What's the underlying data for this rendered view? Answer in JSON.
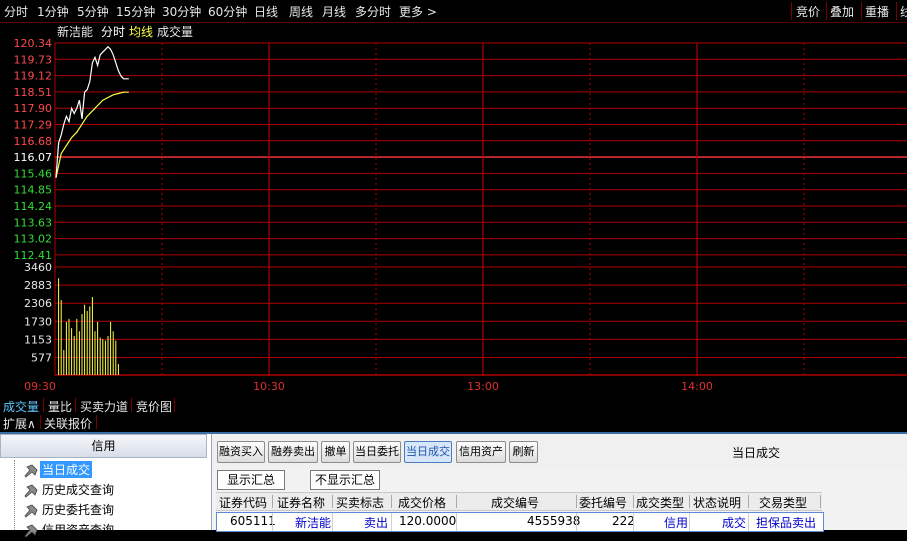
{
  "topbar": {
    "tabs": [
      "分时",
      "1分钟",
      "5分钟",
      "15分钟",
      "30分钟",
      "60分钟",
      "日线",
      "周线",
      "月线",
      "多分时",
      "更多 >"
    ],
    "active_tab": "分时",
    "right_items": [
      "竞价",
      "叠加",
      "重播",
      "线"
    ]
  },
  "chart_header": {
    "stock_name": "新洁能",
    "label_fenshi": "分时",
    "label_junxian": "均线",
    "label_volume": "成交量"
  },
  "colors": {
    "up": "#ff4a4a",
    "down": "#33dd33",
    "base": "#ffffff",
    "grid": "#b00000",
    "price_line": "#ffffff",
    "avg_line": "#ffff44",
    "volume_bar": "#ffff44"
  },
  "chart_data": {
    "type": "line",
    "price_axis": {
      "ticks": [
        "120.34",
        "119.73",
        "119.12",
        "118.51",
        "117.90",
        "117.29",
        "116.68",
        "116.07",
        "115.46",
        "114.85",
        "114.24",
        "113.63",
        "113.02",
        "112.41"
      ],
      "base": "116.07",
      "ylim": [
        112.41,
        120.34
      ]
    },
    "volume_axis": {
      "ticks": [
        "3460",
        "2883",
        "2306",
        "1730",
        "1153",
        "577"
      ],
      "ylim": [
        0,
        3460
      ]
    },
    "time_axis": [
      "09:30",
      "10:30",
      "13:00",
      "14:00"
    ],
    "total_minutes": 240,
    "series": [
      {
        "name": "分时",
        "x": [
          0,
          1,
          2,
          3,
          4,
          5,
          6,
          7,
          8,
          9,
          10,
          11,
          12,
          13,
          14,
          15,
          16,
          17,
          18,
          19,
          20,
          21,
          22,
          23,
          24,
          25,
          26,
          27,
          28
        ],
        "values": [
          115.3,
          116.6,
          116.9,
          117.3,
          117.6,
          117.4,
          117.9,
          117.7,
          117.9,
          118.2,
          117.5,
          118.5,
          118.6,
          118.9,
          119.6,
          119.8,
          119.5,
          119.9,
          120.0,
          120.1,
          120.2,
          120.1,
          119.9,
          119.6,
          119.3,
          119.1,
          119.0,
          119.0,
          119.0
        ]
      },
      {
        "name": "均线",
        "x": [
          0,
          2,
          4,
          6,
          8,
          10,
          12,
          14,
          16,
          18,
          20,
          22,
          24,
          26,
          28
        ],
        "values": [
          115.3,
          116.2,
          116.5,
          116.8,
          117.0,
          117.3,
          117.6,
          117.8,
          118.0,
          118.2,
          118.3,
          118.4,
          118.45,
          118.5,
          118.5
        ]
      }
    ],
    "volume": {
      "x": [
        1,
        2,
        3,
        4,
        5,
        6,
        7,
        8,
        9,
        10,
        11,
        12,
        13,
        14,
        15,
        16,
        17,
        18,
        19,
        20,
        21,
        22,
        23,
        24
      ],
      "values": [
        3100,
        2400,
        800,
        1700,
        1800,
        1500,
        1250,
        1800,
        1400,
        1950,
        2250,
        2050,
        2200,
        2500,
        1400,
        1700,
        1200,
        1150,
        1100,
        1250,
        1700,
        1400,
        1100,
        350
      ]
    }
  },
  "bottom_tabs": [
    "成交量",
    "量比",
    "买卖力道",
    "竞价图"
  ],
  "bottom_active": "成交量",
  "sub_tabs": [
    "扩展∧",
    "关联报价"
  ],
  "left_panel": {
    "title": "信用",
    "items": [
      "当日成交",
      "历史成交查询",
      "历史委托查询",
      "信用资产查询"
    ],
    "selected": "当日成交"
  },
  "toolbar": {
    "buttons": [
      "融资买入",
      "融券卖出",
      "撤单",
      "当日委托",
      "当日成交",
      "信用资产",
      "刷新"
    ],
    "active": "当日成交",
    "panel_title": "当日成交",
    "show_summary": "显示汇总",
    "hide_summary": "不显示汇总"
  },
  "table": {
    "headers": [
      "证券代码",
      "证券名称",
      "买卖标志",
      "成交价格",
      "成交编号",
      "委托编号",
      "成交类型",
      "状态说明",
      "交易类型"
    ],
    "rows": [
      [
        "605111",
        "新洁能",
        "卖出",
        "120.0000",
        "4555938",
        "222",
        "信用",
        "成交",
        "担保品卖出"
      ]
    ]
  }
}
